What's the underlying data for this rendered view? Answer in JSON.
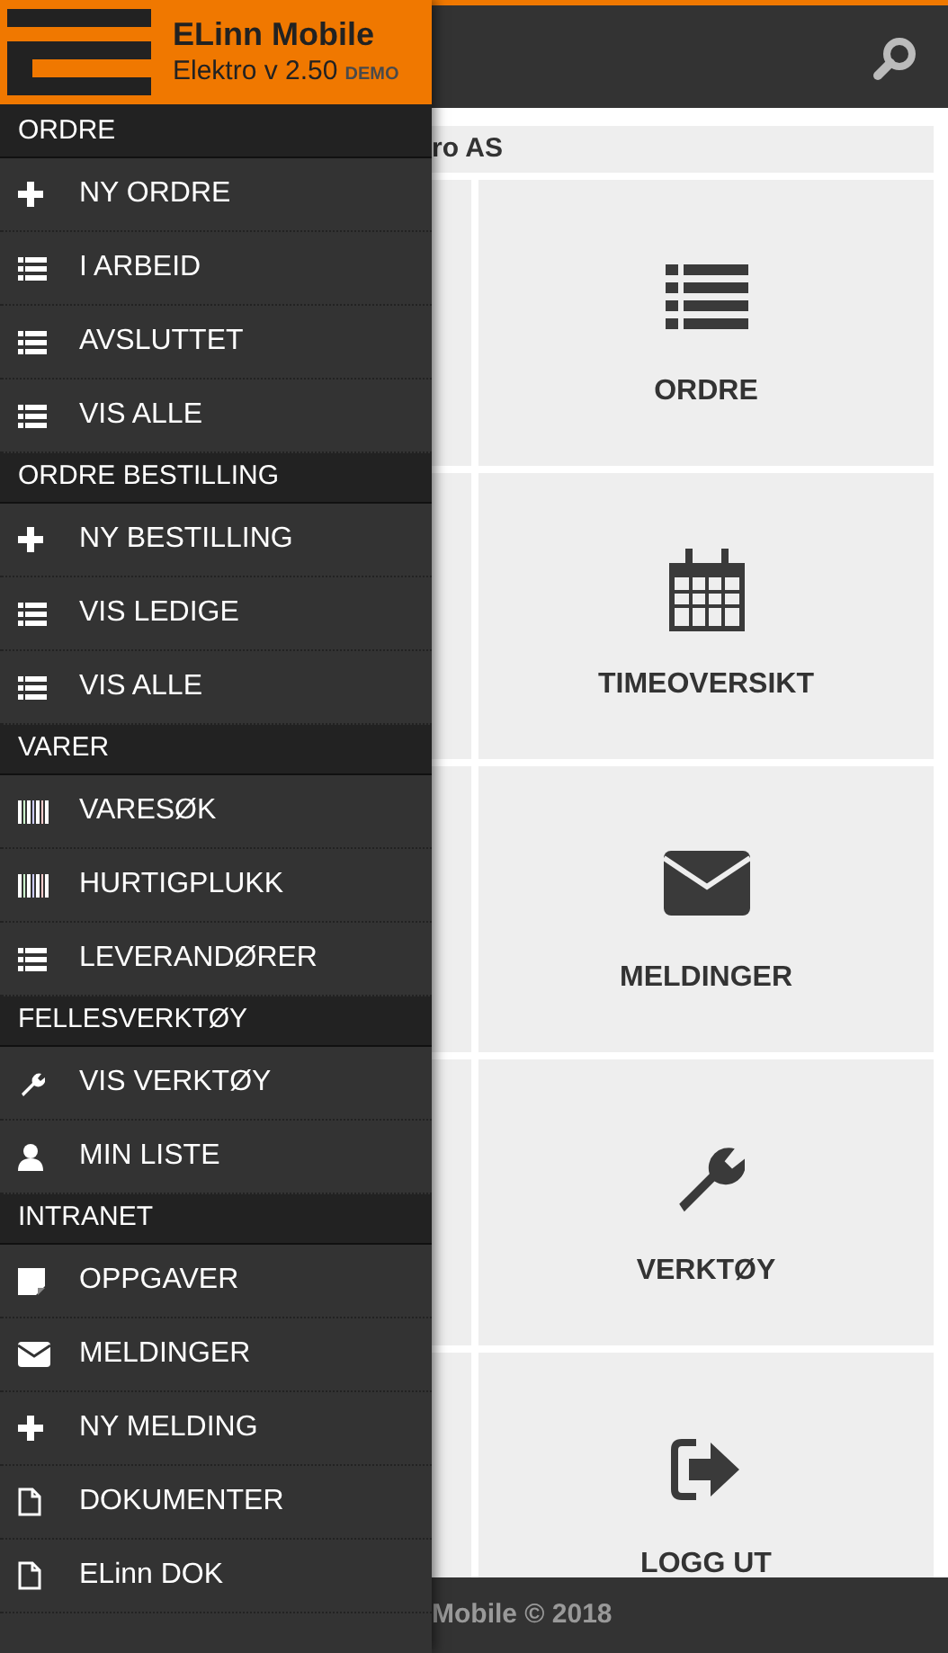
{
  "drawer": {
    "app_name": "ELinn Mobile",
    "version": "Elektro v 2.50",
    "badge": "DEMO",
    "sections": [
      {
        "title": "ORDRE",
        "items": [
          "NY ORDRE",
          "I ARBEID",
          "AVSLUTTET",
          "VIS ALLE"
        ]
      },
      {
        "title": "ORDRE BESTILLING",
        "items": [
          "NY BESTILLING",
          "VIS LEDIGE",
          "VIS ALLE"
        ]
      },
      {
        "title": "VARER",
        "items": [
          "VARESØK",
          "HURTIGPLUKK",
          "LEVERANDØRER"
        ]
      },
      {
        "title": "FELLESVERKTØY",
        "items": [
          "VIS VERKTØY",
          "MIN LISTE"
        ]
      },
      {
        "title": "INTRANET",
        "items": [
          "OPPGAVER",
          "MELDINGER",
          "NY MELDING",
          "DOKUMENTER",
          "ELinn DOK"
        ]
      }
    ]
  },
  "company": "ro AS",
  "tiles": [
    "ORDRE",
    "TIMEOVERSIKT",
    "MELDINGER",
    "VERKTØY",
    "LOGG UT"
  ],
  "footer": "Mobile © 2018"
}
